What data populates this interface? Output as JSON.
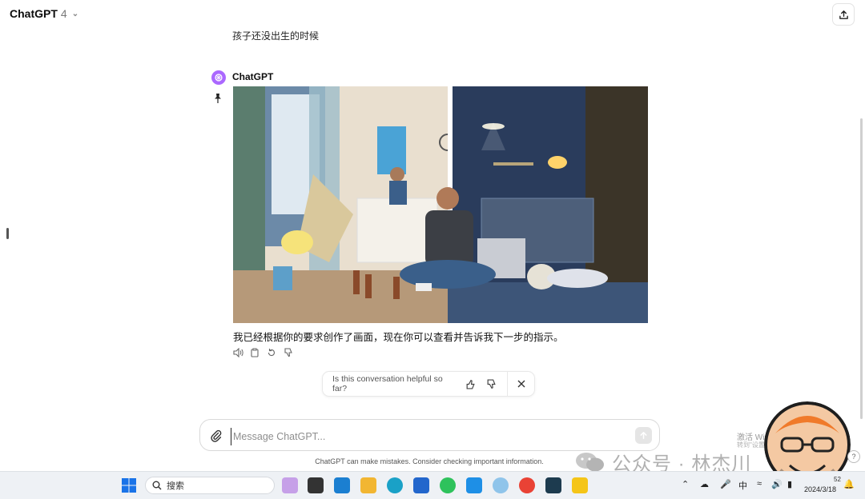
{
  "header": {
    "title": "ChatGPT",
    "version": "4"
  },
  "conversation": {
    "user_message": "孩子还没出生的时候",
    "assistant_name": "ChatGPT",
    "assistant_reply": "我已经根据你的要求创作了画面，现在你可以查看并告诉我下一步的指示。"
  },
  "feedback": {
    "question": "Is this conversation helpful so far?"
  },
  "composer": {
    "placeholder": "Message ChatGPT..."
  },
  "disclaimer": "ChatGPT can make mistakes. Consider checking important information.",
  "watermark": {
    "text": "公众号 · 林杰川"
  },
  "activate": {
    "line1": "激活 Windows",
    "line2": "转到\"设置\"以激活 Windows。"
  },
  "taskbar": {
    "search_label": "搜索",
    "ime": "中",
    "date": "2024/3/18",
    "time": "52"
  },
  "colors": {
    "accent": "#ab68ff",
    "taskbar_bg": "#eef1f5"
  }
}
